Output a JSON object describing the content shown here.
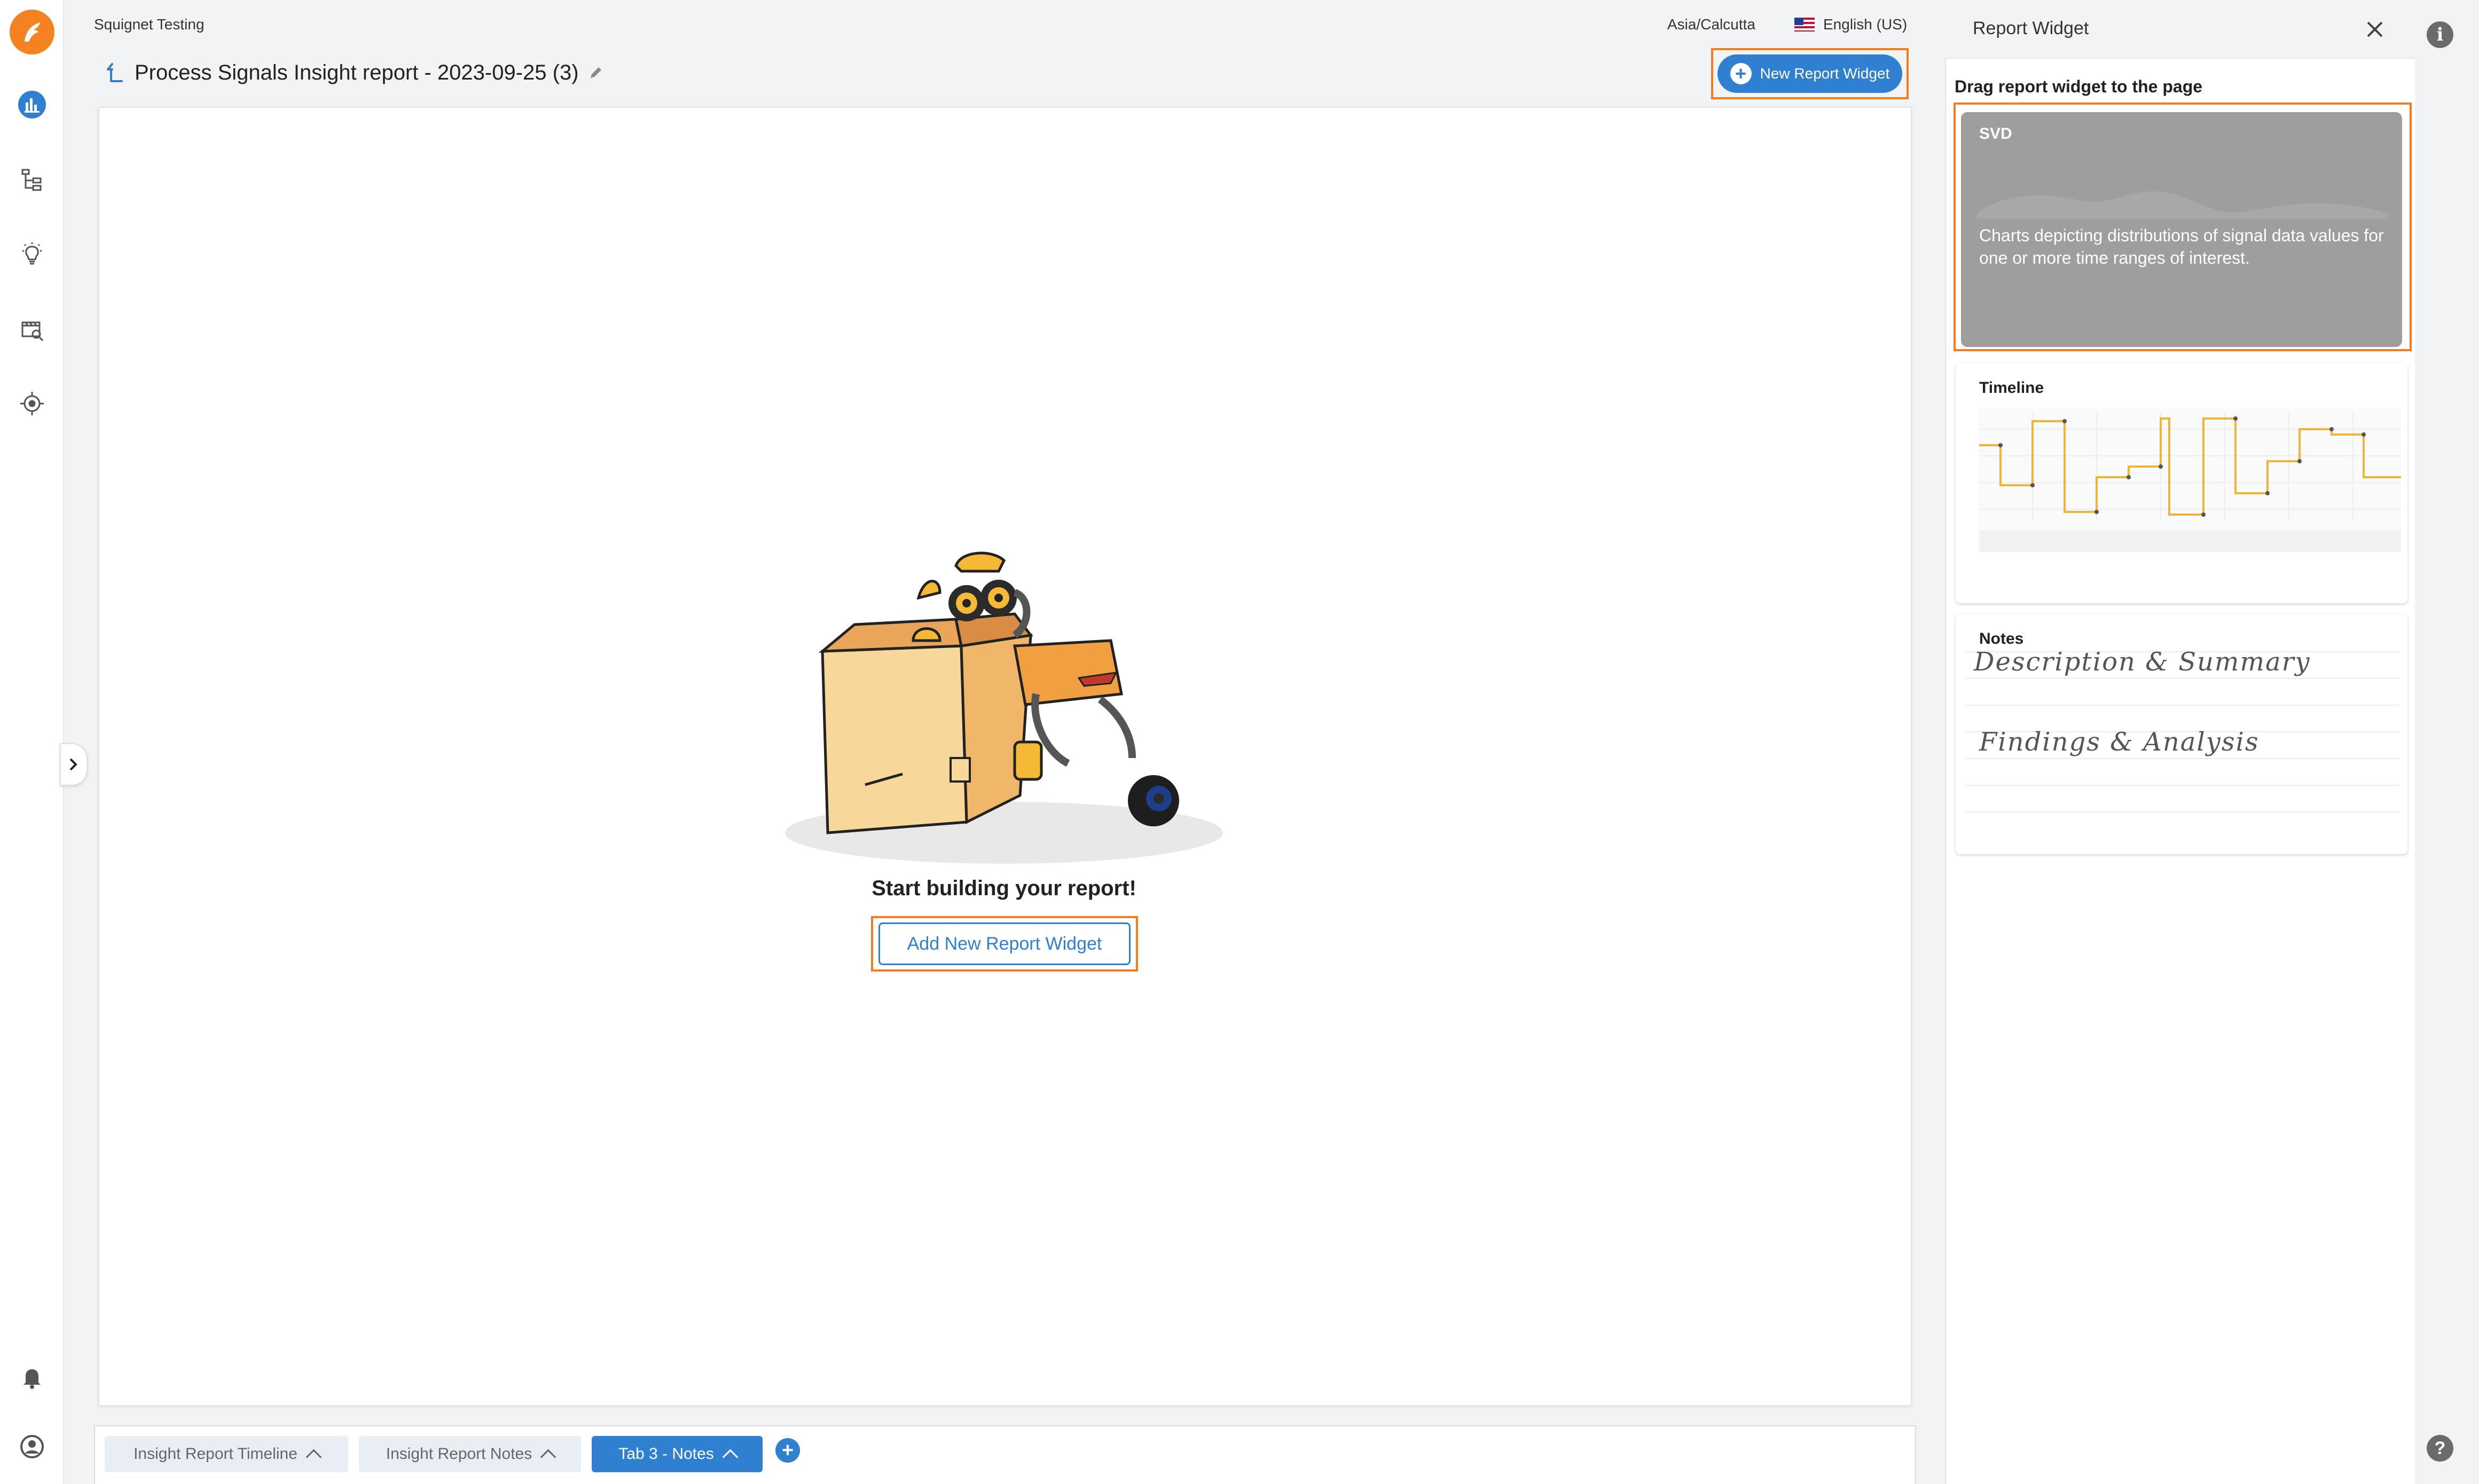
{
  "header": {
    "org_name": "Squignet Testing",
    "timezone": "Asia/Calcutta",
    "language": "English (US)",
    "report_title": "Process Signals Insight report - 2023-09-25 (3)",
    "new_widget_label": "New Report Widget"
  },
  "nav": {
    "items": [
      "logo-icon",
      "analytics-icon",
      "hierarchy-icon",
      "lightbulb-icon",
      "video-search-icon",
      "target-icon",
      "bell-icon",
      "account-icon"
    ]
  },
  "canvas": {
    "empty_title": "Start building your report!",
    "add_button_label": "Add New Report Widget"
  },
  "tabs": [
    {
      "label": "Insight Report Timeline",
      "active": false
    },
    {
      "label": "Insight Report Notes",
      "active": false
    },
    {
      "label": "Tab 3 - Notes",
      "active": true
    }
  ],
  "panel": {
    "title": "Report Widget",
    "subtitle": "Drag report widget to the page",
    "widgets": {
      "svd": {
        "label": "SVD",
        "description": "Charts depicting distributions of signal data values for one or more time ranges of interest."
      },
      "timeline": {
        "label": "Timeline"
      },
      "notes": {
        "label": "Notes",
        "line1": "Description & Summary",
        "line2": "Findings & Analysis"
      }
    }
  },
  "colors": {
    "accent": "#2f80d1",
    "highlight": "#f47b20",
    "brand": "#f58220"
  }
}
